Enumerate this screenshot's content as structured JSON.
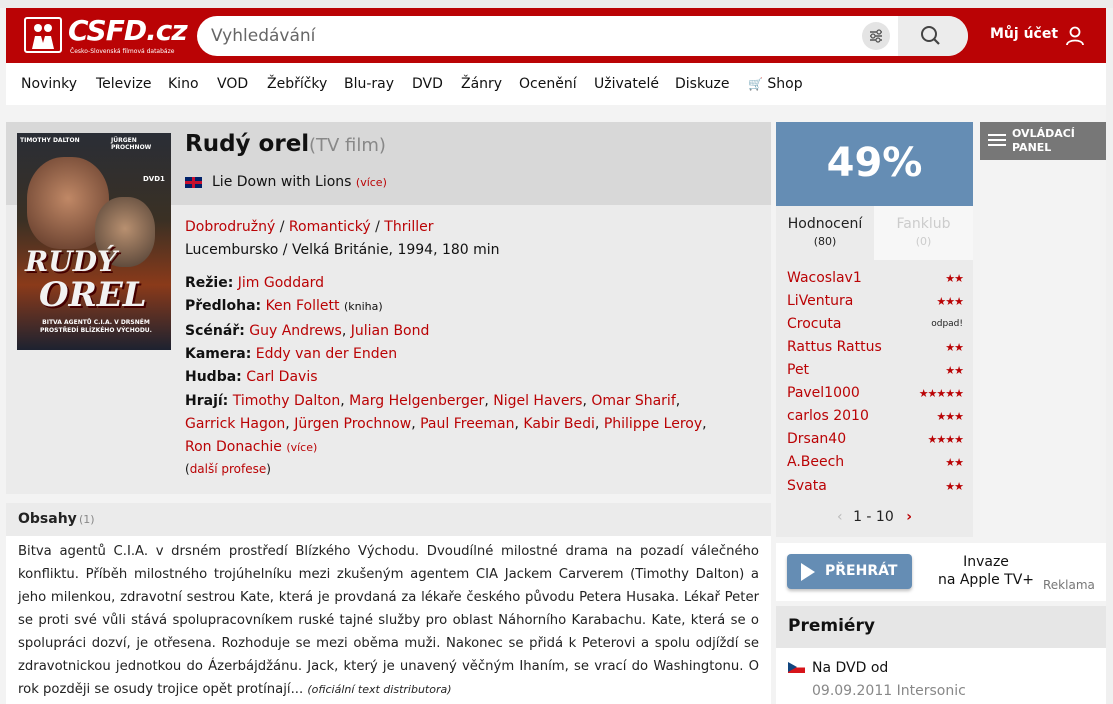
{
  "header": {
    "logo_text": "CSFD.cz",
    "logo_subtitle": "Česko-Slovenská filmová databáze",
    "search_placeholder": "Vyhledávání",
    "account_label": "Můj účet"
  },
  "nav": [
    "Novinky",
    "Televize",
    "Kino",
    "VOD",
    "Žebříčky",
    "Blu-ray",
    "DVD",
    "Žánry",
    "Ocenění",
    "Uživatelé",
    "Diskuze",
    "Shop"
  ],
  "poster": {
    "actor1": "TIMOTHY DALTON",
    "actor2": "JÜRGEN PROCHNOW",
    "dvd": "DVD1",
    "title_line1": "RUDÝ",
    "title_line2": "OREL",
    "tagline": "BITVA AGENTŮ C.I.A. V DRSNÉM PROSTŘEDÍ BLÍZKÉHO VÝCHODU."
  },
  "film": {
    "title": "Rudý orel",
    "type": "(TV film)",
    "alt_title": "Lie Down with Lions",
    "alt_more": "(více)",
    "genres": [
      "Dobrodružný",
      "Romantický",
      "Thriller"
    ],
    "origin": "Lucembursko / Velká Británie, 1994, 180 min",
    "directing_label": "Režie:",
    "directing": "Jim Goddard",
    "source_label": "Předloha:",
    "source": "Ken Follett",
    "source_note": "(kniha)",
    "writers_label": "Scénář:",
    "writers": [
      "Guy Andrews",
      "Julian Bond"
    ],
    "camera_label": "Kamera:",
    "camera": "Eddy van der Enden",
    "music_label": "Hudba:",
    "music": "Carl Davis",
    "cast_label": "Hrají:",
    "cast": [
      "Timothy Dalton",
      "Marg Helgenberger",
      "Nigel Havers",
      "Omar Sharif",
      "Garrick Hagon",
      "Jürgen Prochnow",
      "Paul Freeman",
      "Kabir Bedi",
      "Philippe Leroy",
      "Ron Donachie"
    ],
    "cast_more": "(více)",
    "more_professions": "další profese"
  },
  "plot": {
    "title": "Obsahy",
    "count": "(1)",
    "text": "Bitva agentů C.I.A. v drsném prostředí Blízkého Východu. Dvoudílné milostné drama na pozadí válečného konfliktu. Příběh milostného trojúhelníku mezi zkušeným agentem CIA Jackem Carverem (Timothy Dalton) a jeho milenkou, zdravotní sestrou Kate, která je provdaná za lékaře českého původu Petera Husaka. Lékař Peter se proti své vůli stává spolupracovníkem ruské tajné služby pro oblast Náhorního Karabachu. Kate, která se o spolupráci dozví, je otřesena. Rozhoduje se mezi oběma muži. Nakonec se přidá k Peterovi a spolu odjíždí se zdravotnickou jednotkou do Ázerbájdžánu. Jack, který je unavený věčným Ihaním, se vrací do Washingtonu. O rok později se osudy trojice opět protínají...",
    "source": "(oficiální text distributora)"
  },
  "rating": {
    "value": "49%",
    "tab_ratings": "Hodnocení",
    "tab_ratings_count": "(80)",
    "tab_fanclub": "Fanklub",
    "tab_fanclub_count": "(0)",
    "users": [
      {
        "name": "Wacoslav1",
        "stars": 2
      },
      {
        "name": "LiVentura",
        "stars": 3
      },
      {
        "name": "Crocuta",
        "stars": 0,
        "text": "odpad!"
      },
      {
        "name": "Rattus Rattus",
        "stars": 2
      },
      {
        "name": "Pet",
        "stars": 2
      },
      {
        "name": "Pavel1000",
        "stars": 5
      },
      {
        "name": "carlos 2010",
        "stars": 3
      },
      {
        "name": "Drsan40",
        "stars": 4
      },
      {
        "name": "A.Beech",
        "stars": 2
      },
      {
        "name": "Svata",
        "stars": 2
      }
    ],
    "pager": "1 - 10"
  },
  "control_panel": "OVLÁDACÍ PANEL",
  "play": {
    "button": "PŘEHRÁT",
    "line1": "Invaze",
    "line2": "na Apple TV+",
    "ad": "Reklama"
  },
  "premieres": {
    "title": "Premiéry",
    "label": "Na DVD od",
    "date": "09.09.2011 Intersonic"
  },
  "colors": {
    "brand_red": "#ba0305",
    "rating_blue": "#658db4"
  }
}
